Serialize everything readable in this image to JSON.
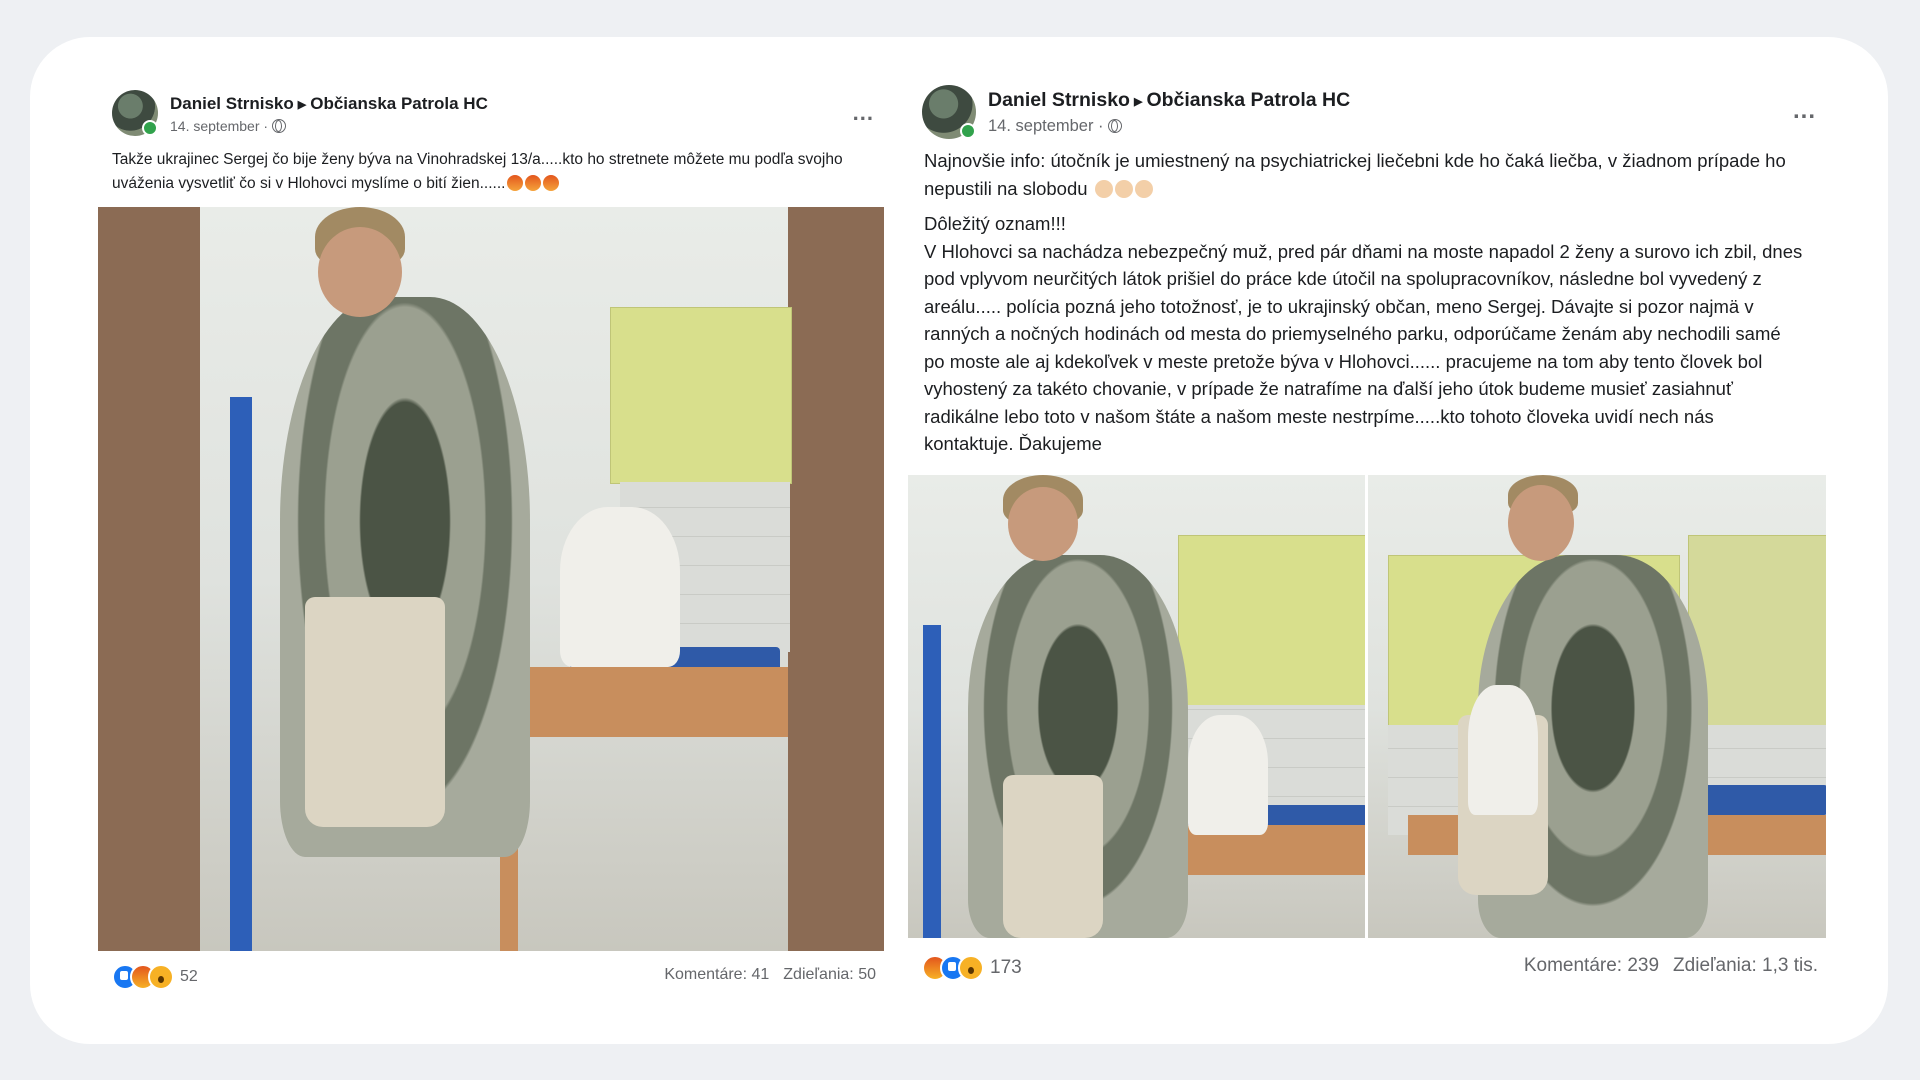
{
  "post1": {
    "author": "Daniel Strnisko",
    "group": "Občianska Patrola HC",
    "date": "14. september ·",
    "text": "Takže ukrajinec Sergej čo bije ženy býva na Vinohradskej 13/a.....kto ho stretnete môžete mu podľa svojho uváženia vysvetliť čo si v Hlohovci myslíme o bití žien......",
    "reactions_icons": [
      "like",
      "angry",
      "wow"
    ],
    "reactions_count": "52",
    "comments": "Komentáre: 41",
    "shares": "Zdieľania: 50",
    "more": "..."
  },
  "post2": {
    "author": "Daniel Strnisko",
    "group": "Občianska Patrola HC",
    "date": "14. september ·",
    "text_update": "Najnovšie info:  útočník je umiestnený na psychiatrickej liečebni kde ho čaká liečba, v žiadnom prípade ho nepustili na slobodu",
    "text_heading": "Dôležitý oznam!!!",
    "text_body": "V Hlohovci sa nachádza nebezpečný muž, pred pár dňami na moste napadol 2 ženy a surovo ich zbil,  dnes pod vplyvom neurčitých látok prišiel do práce kde útočil na spolupracovníkov, následne bol vyvedený z areálu..... polícia pozná jeho totožnosť, je to ukrajinský občan, meno Sergej. Dávajte si pozor najmä v ranných a nočných hodinách od mesta do priemyselného parku, odporúčame ženám aby nechodili samé po moste ale aj kdekoľvek v meste pretože býva v Hlohovci...... pracujeme na tom aby tento človek bol vyhostený za takéto chovanie, v prípade že natrafíme na ďalší jeho útok budeme musieť zasiahnuť radikálne lebo toto v našom štáte a našom meste nestrpíme.....kto tohoto človeka uvidí nech nás kontaktuje. Ďakujeme",
    "reactions_icons": [
      "angry",
      "like",
      "wow"
    ],
    "reactions_count": "173",
    "comments": "Komentáre: 239",
    "shares": "Zdieľania: 1,3 tis.",
    "more": "..."
  }
}
